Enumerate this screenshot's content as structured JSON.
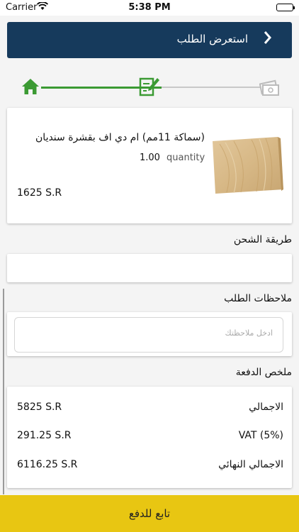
{
  "status_bar": {
    "carrier": "Carrier",
    "time": "5:38 PM"
  },
  "header": {
    "title": "استعرض الطلب",
    "back_icon": "chevron-right-icon"
  },
  "steps": [
    {
      "icon": "home-icon",
      "state": "done"
    },
    {
      "icon": "edit-form-icon",
      "state": "current"
    },
    {
      "icon": "payment-icon",
      "state": "pending"
    }
  ],
  "colors": {
    "header": "#163a5c",
    "step_active": "#3b9a33",
    "pay_button": "#e8c612"
  },
  "product": {
    "name": "(سماكة 11مم) ام دي اف بقشرة سنديان",
    "quantity_label": "quantity",
    "quantity_value": "1.00",
    "price": "1625 S.R"
  },
  "shipping": {
    "label": "طريقة الشحن"
  },
  "notes": {
    "label": "ملاحظات الطلب",
    "placeholder": "ادخل ملاحظتك"
  },
  "summary": {
    "label": "ملخص الدفعة",
    "rows": [
      {
        "label": "الاجمالي",
        "value": "5825 S.R"
      },
      {
        "label": "VAT (5%)",
        "value": "291.25 S.R"
      },
      {
        "label": "الاجمالي النهائي",
        "value": "6116.25 S.R"
      }
    ]
  },
  "footer": {
    "button_label": "تابع للدفع"
  }
}
